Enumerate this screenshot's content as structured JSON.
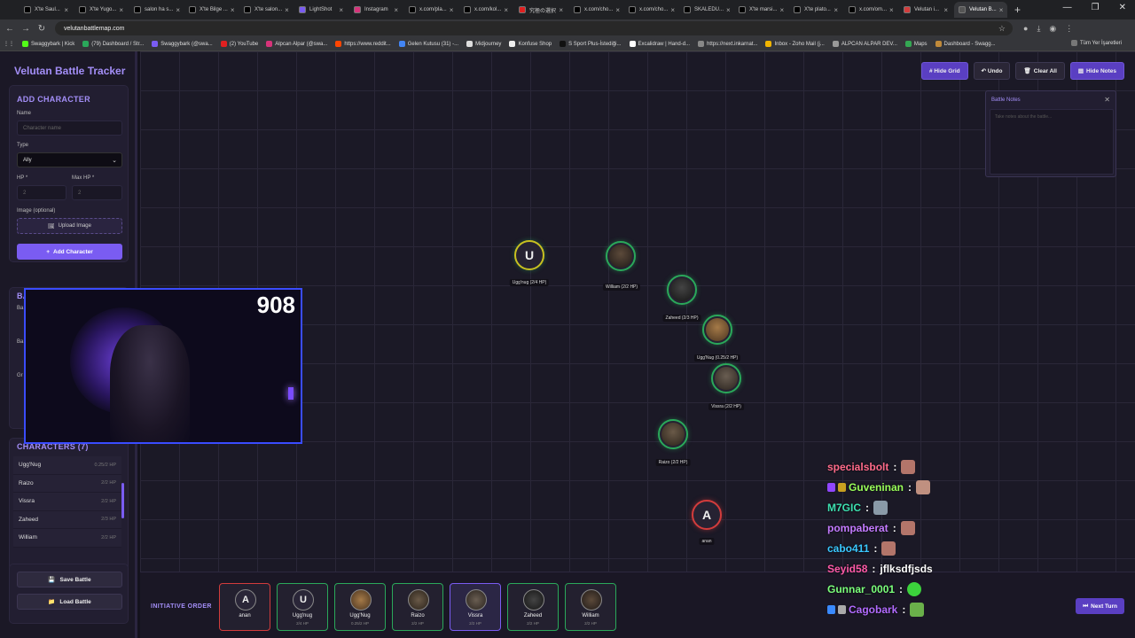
{
  "browser": {
    "tabs": [
      "X'te Saul...",
      "X'te Yugo...",
      "salon ha s...",
      "X'te Bilge ...",
      "X'te salon...",
      "LightShot",
      "Instagram",
      "x.com/pla...",
      "x.com/kol...",
      "究極の選択",
      "x.com/cho...",
      "x.com/cho...",
      "SKALEDU...",
      "X'te marsi...",
      "X'te plato...",
      "x.com/om...",
      "Velutan i...",
      "Velutan B..."
    ],
    "url": "velutanbattlemap.com",
    "bookmarks": [
      "Swaggybark | Kick",
      "(79) Dashboard / Str...",
      "Swaggybark (@swa...",
      "(2) YouTube",
      "Alpcan Alpar (@swa...",
      "https://www.reddit...",
      "Gelen Kutusu (31) -...",
      "Midjourney",
      "Konfuse Shop",
      "S Sport Plus-İstediği...",
      "Excalidraw | Hand-d...",
      "https://next.inkarnat...",
      "Inbox - Zoho Mail (j...",
      "ALPCAN ALPAR DEV...",
      "Maps",
      "Dashboard - Swagg..."
    ],
    "bookmarks_all": "Tüm Yer İşaretleri"
  },
  "sidebar": {
    "app_title": "Velutan Battle Tracker",
    "add_character": {
      "title": "ADD CHARACTER",
      "name_label": "Name",
      "name_placeholder": "Character name",
      "type_label": "Type",
      "type_value": "Ally",
      "hp_label": "HP *",
      "hp_placeholder": "2",
      "maxhp_label": "Max HP *",
      "maxhp_placeholder": "2",
      "image_label": "Image (optional)",
      "upload_label": "Upload Image",
      "add_button": "Add Character"
    },
    "background_panel": {
      "title_fragment": "BA",
      "label_1": "Ba",
      "label_2": "Ba",
      "label_3": "Gr"
    },
    "characters": {
      "title": "CHARACTERS (7)",
      "items": [
        {
          "name": "Ugg'Nug",
          "hp": "0.25/2 HP"
        },
        {
          "name": "Raizo",
          "hp": "2/2 HP"
        },
        {
          "name": "Vissra",
          "hp": "2/2 HP"
        },
        {
          "name": "Zaheed",
          "hp": "2/3 HP"
        },
        {
          "name": "William",
          "hp": "2/2 HP"
        }
      ]
    },
    "save_button": "Save Battle",
    "load_button": "Load Battle"
  },
  "map": {
    "buttons": {
      "grid": "# Hide Grid",
      "undo": "↶ Undo",
      "clear": "Clear All",
      "notes": "Hide Notes"
    },
    "notes": {
      "title": "Battle Notes",
      "placeholder": "Take notes about the battle..."
    },
    "tokens": [
      {
        "letter": "U",
        "label": "Ugg'nug (2/4 HP)"
      },
      {
        "letter": "",
        "label": "William (2/2 HP)"
      },
      {
        "letter": "",
        "label": "Zaheed (2/3 HP)"
      },
      {
        "letter": "",
        "label": "Ugg'Nug (0.25/2 HP)"
      },
      {
        "letter": "",
        "label": "Vissra (2/2 HP)"
      },
      {
        "letter": "",
        "label": "Raizo (2/2 HP)"
      },
      {
        "letter": "A",
        "label": "anan"
      }
    ]
  },
  "initiative": {
    "label": "INITIATIVE ORDER",
    "cards": [
      {
        "letter": "A",
        "name": "anan",
        "hp": ""
      },
      {
        "letter": "U",
        "name": "Ugg'nug",
        "hp": "2/4 HP"
      },
      {
        "letter": "",
        "name": "Ugg'Nug",
        "hp": "0.25/2 HP"
      },
      {
        "letter": "",
        "name": "Raizo",
        "hp": "2/2 HP"
      },
      {
        "letter": "",
        "name": "Vissra",
        "hp": "2/2 HP"
      },
      {
        "letter": "",
        "name": "Zaheed",
        "hp": "2/2 HP"
      },
      {
        "letter": "",
        "name": "William",
        "hp": "2/2 HP"
      }
    ],
    "next_turn": "Next Turn"
  },
  "overlay": {
    "webcam_count": "908",
    "chat": [
      {
        "user": "specialsbolt",
        "color": "#ff6b8a",
        "text": ""
      },
      {
        "user": "Guveninan",
        "color": "#9aff5a",
        "text": ""
      },
      {
        "user": "M7GIC",
        "color": "#3de0b0",
        "text": ""
      },
      {
        "user": "pompaberat",
        "color": "#c47bff",
        "text": ""
      },
      {
        "user": "cabo411",
        "color": "#3ac8ff",
        "text": ""
      },
      {
        "user": "Seyid58",
        "color": "#ff5aa8",
        "text": "jflksdfjsds"
      },
      {
        "user": "Gunnar_0001",
        "color": "#7bff7b",
        "text": ""
      },
      {
        "user": "Cagobark",
        "color": "#b26bff",
        "text": ""
      }
    ]
  }
}
